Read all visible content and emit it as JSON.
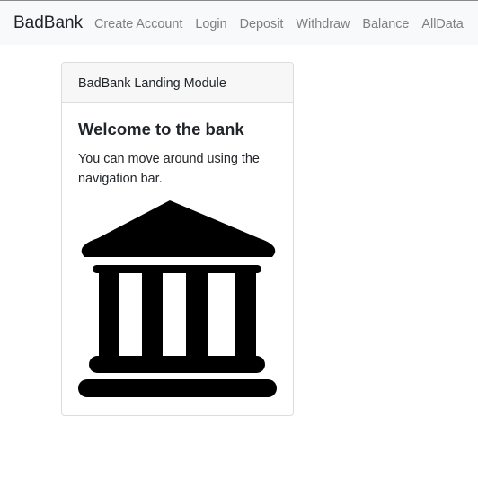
{
  "navbar": {
    "brand": "BadBank",
    "links": [
      {
        "label": "Create Account"
      },
      {
        "label": "Login"
      },
      {
        "label": "Deposit"
      },
      {
        "label": "Withdraw"
      },
      {
        "label": "Balance"
      },
      {
        "label": "AllData"
      }
    ]
  },
  "card": {
    "header": "BadBank Landing Module",
    "title": "Welcome to the bank",
    "text": "You can move around using the navigation bar.",
    "icon": "bank-building-icon"
  },
  "colors": {
    "navbar_bg": "#f8f9fa",
    "nav_link": "#7f7f7f",
    "card_header_bg": "#f7f7f7",
    "card_border": "#dcdcdc",
    "text": "#212529"
  }
}
